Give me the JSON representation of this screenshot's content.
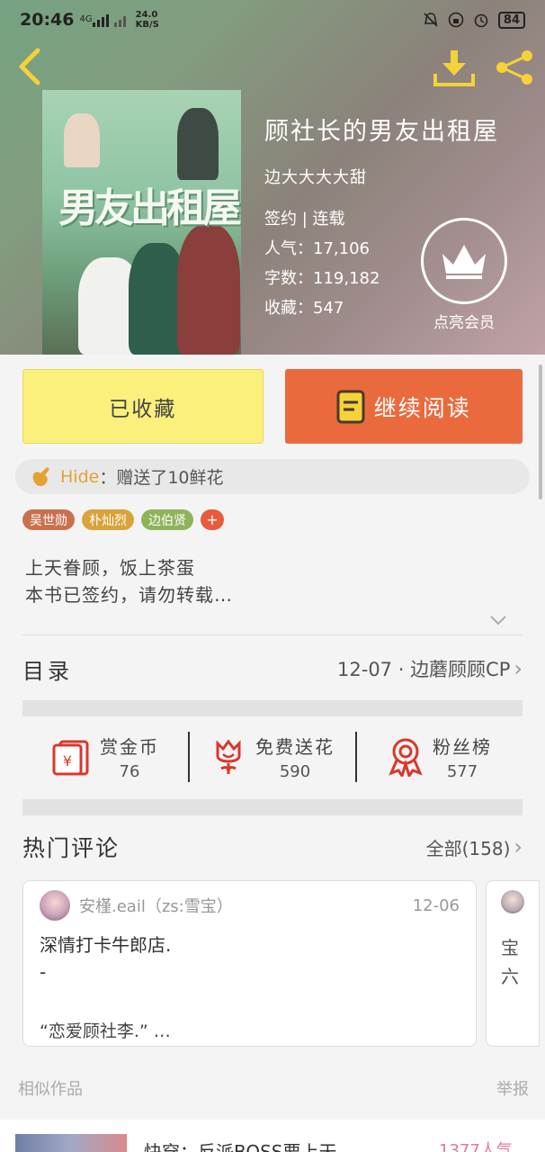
{
  "status_bar": {
    "time": "20:46",
    "network": "4G",
    "speed_value": "24.0",
    "speed_unit": "KB/S",
    "battery": "84"
  },
  "book": {
    "title": "顾社长的男友出租屋",
    "author": "边大大大大甜",
    "status": "签约 | 连载",
    "popularity": "人气：17,106",
    "word_count": "字数：119,182",
    "favorites": "收藏：547",
    "cover_text": "男友出租屋"
  },
  "vip": {
    "label": "点亮会员"
  },
  "actions": {
    "collected": "已收藏",
    "continue_reading": "继续阅读"
  },
  "gift": {
    "user": "Hide",
    "text": "：赠送了10鲜花"
  },
  "tags": [
    {
      "label": "吴世勋",
      "color": "#c9714f"
    },
    {
      "label": "朴灿烈",
      "color": "#d9a23b"
    },
    {
      "label": "边伯贤",
      "color": "#8fb35a"
    }
  ],
  "tag_add": "+",
  "intro": {
    "line1": "上天眷顾，饭上茶蛋",
    "line2": "本书已签约，请勿转载…"
  },
  "toc": {
    "label": "目录",
    "latest": "12-07 · 边蘑顾顾CP"
  },
  "stats": [
    {
      "label": "赏金币",
      "value": "76"
    },
    {
      "label": "免费送花",
      "value": "590"
    },
    {
      "label": "粉丝榜",
      "value": "577"
    }
  ],
  "hot_comments": {
    "label": "热门评论",
    "all": "全部(158)"
  },
  "comment": {
    "name": "安槿.eail（zs:雪宝）",
    "date": "12-06",
    "body": "深情打卡牛郎店.",
    "body2": "-",
    "quote": "“恋爱顾社李.” …"
  },
  "comment2": {
    "line1": "宝",
    "line2": "六"
  },
  "similar": {
    "label": "相似作品",
    "report": "举报"
  },
  "recommendation": {
    "title": "快穿：反派BOSS要上天",
    "hot": "1377人气"
  },
  "colors": {
    "accent_orange": "#ea6a3e",
    "collected_yellow": "#fbf07c",
    "gift_user": "#e4a232",
    "icon_red": "#d9382c"
  }
}
